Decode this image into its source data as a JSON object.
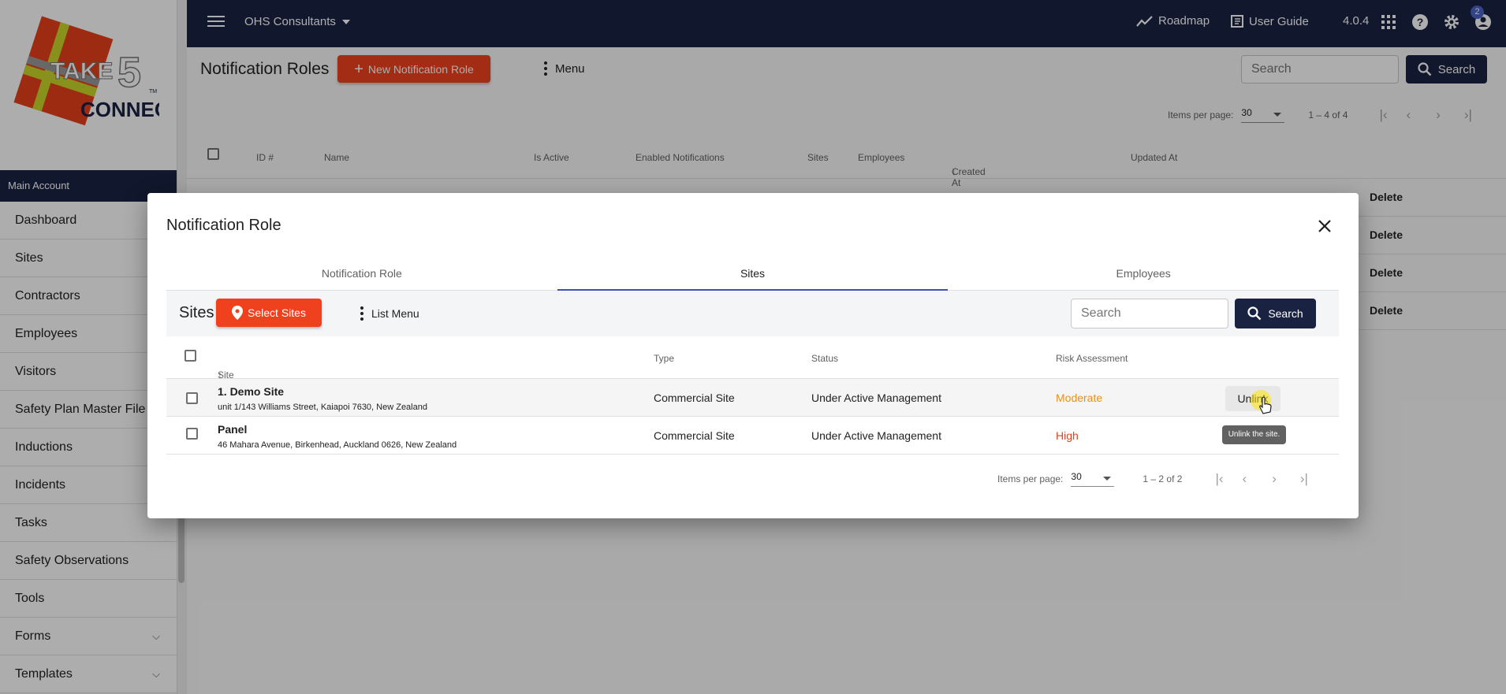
{
  "app": {
    "account_label": "Main Account",
    "org_name": "OHS Consultants",
    "version": "4.0.4",
    "notifications_count": "2"
  },
  "topbar": {
    "roadmap_label": "Roadmap",
    "user_guide_label": "User Guide"
  },
  "sidebar": {
    "items": [
      {
        "label": "Dashboard"
      },
      {
        "label": "Sites"
      },
      {
        "label": "Contractors"
      },
      {
        "label": "Employees"
      },
      {
        "label": "Visitors"
      },
      {
        "label": "Safety Plan Master File"
      },
      {
        "label": "Inductions"
      },
      {
        "label": "Incidents"
      },
      {
        "label": "Tasks"
      },
      {
        "label": "Safety Observations"
      },
      {
        "label": "Tools"
      },
      {
        "label": "Forms"
      },
      {
        "label": "Templates"
      }
    ]
  },
  "page": {
    "title": "Notification Roles",
    "new_button": "New Notification Role",
    "menu_label": "Menu",
    "search_placeholder": "Search",
    "search_button": "Search",
    "items_per_page_label": "Items per page:",
    "items_per_page_value": "30",
    "range_label": "1 – 4 of 4",
    "columns": [
      "ID #",
      "Name",
      "Is Active",
      "Enabled Notifications",
      "Sites",
      "Employees",
      "Created At",
      "Updated At"
    ],
    "delete_label": "Delete"
  },
  "modal": {
    "title": "Notification Role",
    "tabs": [
      "Notification Role",
      "Sites",
      "Employees"
    ],
    "sites_label": "Sites",
    "select_sites_button": "Select Sites",
    "list_menu_label": "List Menu",
    "search_placeholder": "Search",
    "search_button": "Search",
    "columns": [
      "Site Name",
      "Type",
      "Status",
      "Risk Assessment"
    ],
    "rows": [
      {
        "name": "1. Demo Site",
        "address": "unit 1/143 Williams Street, Kaiapoi 7630, New Zealand",
        "type": "Commercial Site",
        "status": "Under Active Management",
        "risk": "Moderate",
        "risk_color": "#e8901a"
      },
      {
        "name": "Panel",
        "address": "46 Mahara Avenue, Birkenhead, Auckland 0626, New Zealand",
        "type": "Commercial Site",
        "status": "Under Active Management",
        "risk": "High",
        "risk_color": "#e8401a"
      }
    ],
    "unlink_label": "Unlink",
    "tooltip": "Unlink the site.",
    "items_per_page_label": "Items per page:",
    "items_per_page_value": "30",
    "range_label": "1 – 2 of 2"
  },
  "colors": {
    "navy": "#1a2242",
    "orange": "#f0411e",
    "tab_indicator": "#3f51b5"
  }
}
